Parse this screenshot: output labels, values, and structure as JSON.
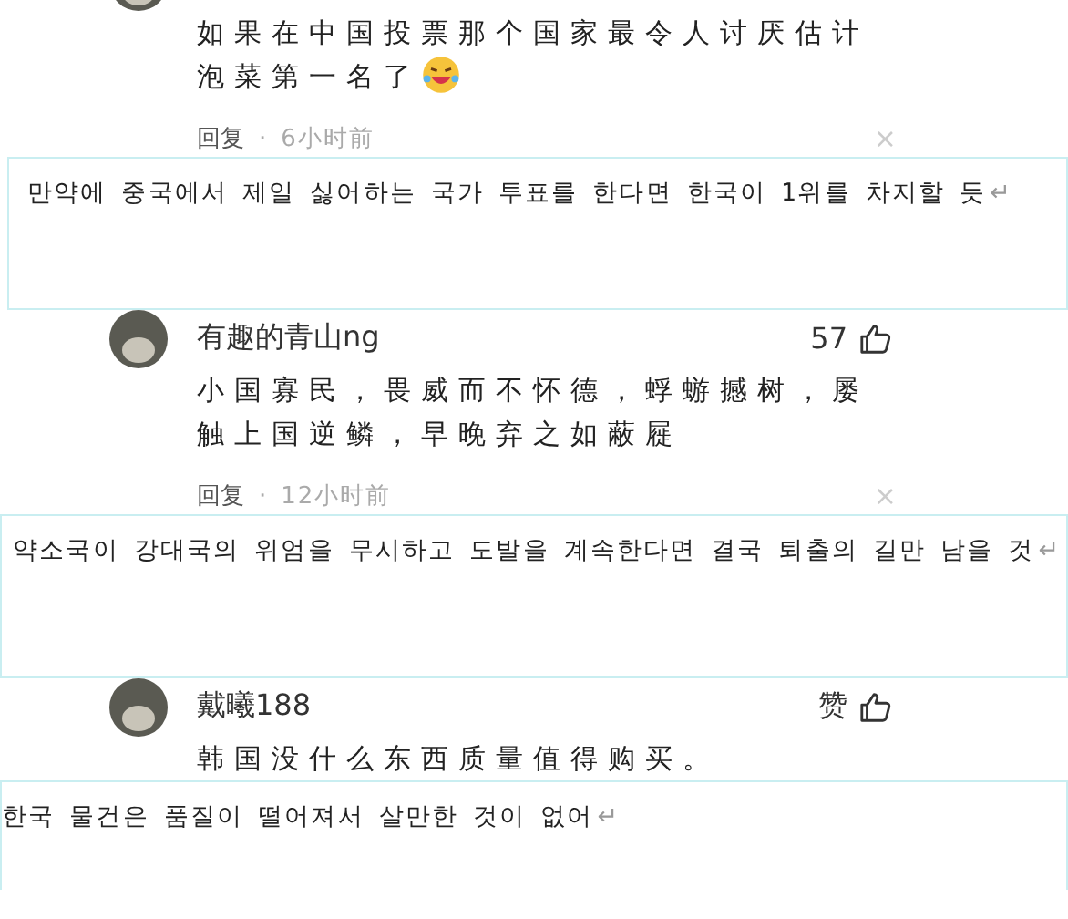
{
  "items": [
    {
      "kind": "comment",
      "text": "如果在中国投票那个国家最令人讨厌估计泡菜第一名了",
      "emoji": true,
      "reply": "回复",
      "separator": "·",
      "time": "6小时前",
      "close": "×"
    },
    {
      "kind": "translation",
      "text": "만약에 중국에서 제일 싫어하는 국가 투표를 한다면 한국이 1위를 차지할 듯",
      "mark": "↵"
    },
    {
      "kind": "comment",
      "username": "有趣的青山ng",
      "likes": "57",
      "text": "小国寡民，畏威而不怀德，蜉蝣撼树，屡触上国逆鳞，早晚弃之如蔽屣",
      "reply": "回复",
      "separator": "·",
      "time": "12小时前",
      "close": "×"
    },
    {
      "kind": "translation",
      "text": "약소국이 강대국의 위엄을 무시하고 도발을 계속한다면 결국 퇴출의 길만 남을 것",
      "mark": "↵"
    },
    {
      "kind": "comment",
      "username": "戴曦188",
      "likes": "赞",
      "text": "韩国没什么东西质量值得购买。"
    },
    {
      "kind": "translation",
      "text": "한국 물건은 품질이 떨어져서 살만한 것이 없어",
      "mark": "↵"
    }
  ]
}
